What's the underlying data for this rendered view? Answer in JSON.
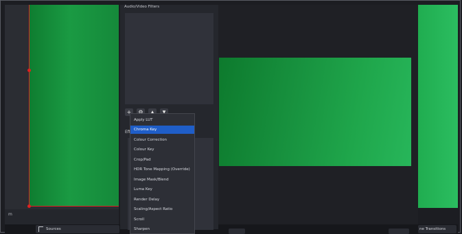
{
  "filters_panel": {
    "title": "Audio/Video Filters",
    "effect_label": "Eff"
  },
  "toolbar": {
    "add": "+",
    "settings": "⚙",
    "up": "▲",
    "down": "▼"
  },
  "context_menu": {
    "items": [
      {
        "label": "Apply LUT",
        "selected": false
      },
      {
        "label": "Chroma Key",
        "selected": true
      },
      {
        "label": "Colour Correction",
        "selected": false
      },
      {
        "label": "Colour Key",
        "selected": false
      },
      {
        "label": "Crop/Pad",
        "selected": false
      },
      {
        "label": "HDR Tone Mapping (Override)",
        "selected": false
      },
      {
        "label": "Image Mask/Blend",
        "selected": false
      },
      {
        "label": "Luma Key",
        "selected": false
      },
      {
        "label": "Render Delay",
        "selected": false
      },
      {
        "label": "Scaling/Aspect Ratio",
        "selected": false
      },
      {
        "label": "Scroll",
        "selected": false
      },
      {
        "label": "Sharpen",
        "selected": false
      }
    ]
  },
  "left_panel": {
    "ribbon_label": "m"
  },
  "docks": {
    "sources_label": "Sources",
    "transitions_label": "ne Transitions"
  },
  "colors": {
    "accent": "#1f5ec8",
    "chroma_green": "#1a9a43",
    "handle_red": "#e02020"
  }
}
